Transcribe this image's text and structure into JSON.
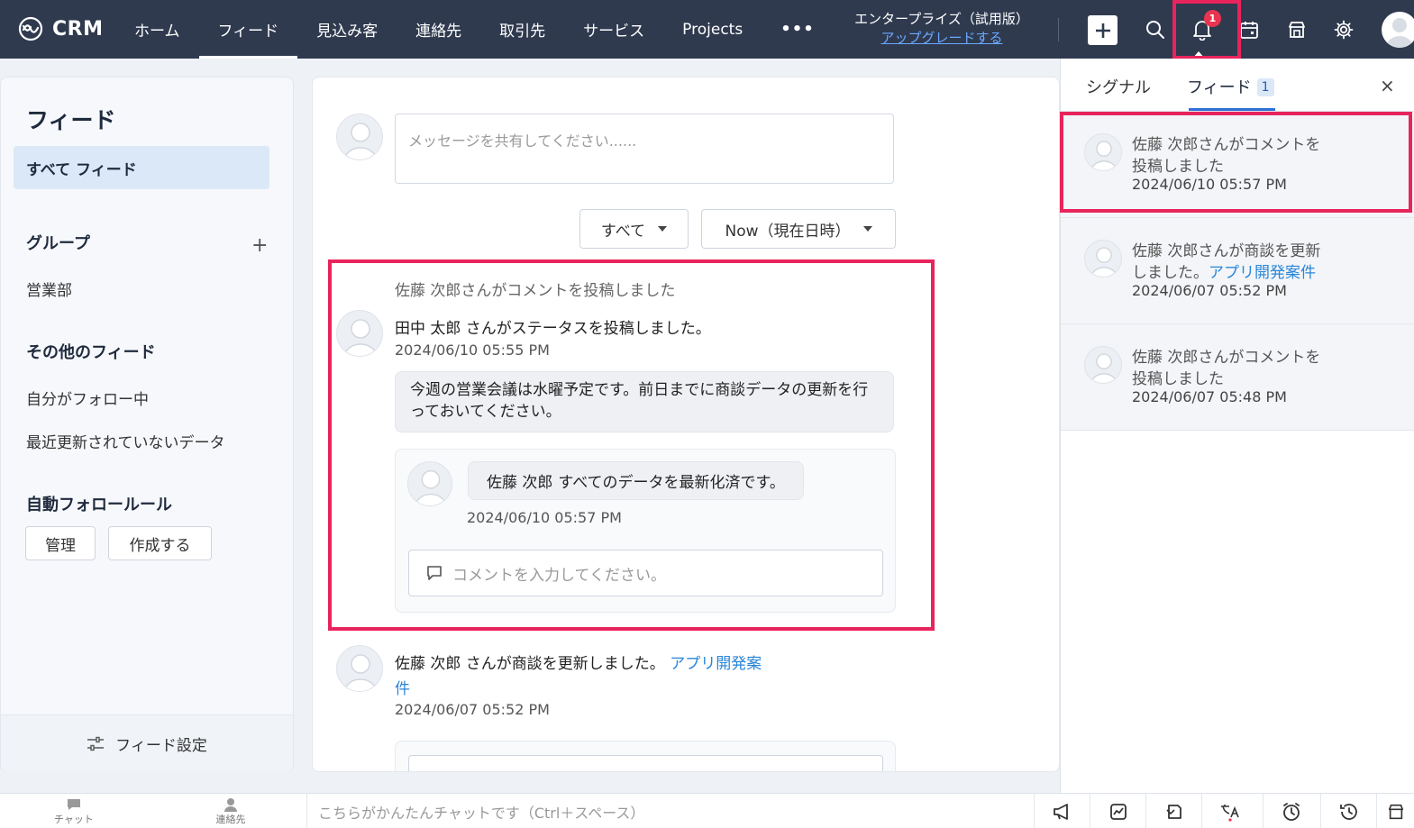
{
  "topbar": {
    "brand": "CRM",
    "tabs": [
      {
        "label": "ホーム"
      },
      {
        "label": "フィード"
      },
      {
        "label": "見込み客"
      },
      {
        "label": "連絡先"
      },
      {
        "label": "取引先"
      },
      {
        "label": "サービス"
      },
      {
        "label": "Projects"
      }
    ],
    "more": "•••",
    "edition": "エンタープライズ（試用版）",
    "upgrade": "アップグレードする",
    "notification_count": "1"
  },
  "sidebar": {
    "title": "フィード",
    "all_feed": "すべて フィード",
    "groups_title": "グループ",
    "groups": [
      "営業部"
    ],
    "other_title": "その他のフィード",
    "other_items": [
      "自分がフォロー中",
      "最近更新されていないデータ"
    ],
    "auto_follow_title": "自動フォロールール",
    "manage_btn": "管理",
    "create_btn": "作成する",
    "settings": "フィード設定"
  },
  "main": {
    "message_placeholder": "メッセージを共有してください......",
    "filter_type": "すべて",
    "filter_time": "Now（現在日時）",
    "post1": {
      "header": "佐藤 次郎さんがコメントを投稿しました",
      "title": "田中 太郎 さんがステータスを投稿しました。",
      "time": "2024/06/10 05:55 PM",
      "status": "今週の営業会議は水曜予定です。前日までに商談データの更新を行っておいてください。",
      "reply_author": "佐藤 次郎",
      "reply_text": "すべてのデータを最新化済です。",
      "reply_time": "2024/06/10 05:57 PM",
      "comment_placeholder": "コメントを入力してください。"
    },
    "post2": {
      "text": "佐藤 次郎 さんが商談を更新しました。",
      "link_line1": "アプリ開発案",
      "link_line2": "件",
      "time": "2024/06/07 05:52 PM"
    }
  },
  "panel": {
    "tab_signal": "シグナル",
    "tab_feed": "フィード",
    "feed_count": "1",
    "close": "×",
    "notifications": [
      {
        "line1": "佐藤 次郎さんがコメントを",
        "line2": "投稿しました",
        "link": "",
        "time": "2024/06/10 05:57 PM"
      },
      {
        "line1": "佐藤 次郎さんが商談を更新",
        "line2": "しました。",
        "link": "アプリ開発案件",
        "time": "2024/06/07 05:52 PM"
      },
      {
        "line1": "佐藤 次郎さんがコメントを",
        "line2": "投稿しました",
        "link": "",
        "time": "2024/06/07 05:48 PM"
      }
    ]
  },
  "bottombar": {
    "chat": "チャット",
    "contacts": "連絡先",
    "chat_placeholder": "こちらがかんたんチャットです（Ctrl＋スペース）"
  },
  "colors": {
    "topbar": "#2f3a4f",
    "highlight": "#e8245c",
    "link": "#2a86d8",
    "badge": "#e8344e"
  }
}
